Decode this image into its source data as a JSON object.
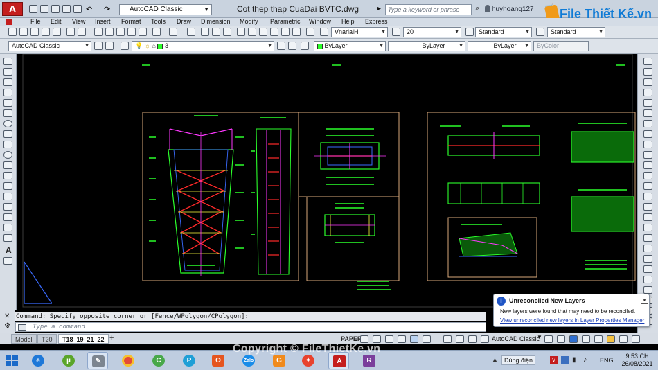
{
  "titlebar": {
    "app_logo": "A",
    "workspace": "AutoCAD Classic",
    "document_title": "Cot thep thap CuaDai BVTC.dwg",
    "search_placeholder": "Type a keyword or phrase",
    "user": "huyhoang127",
    "brand_text": "File Thiết Kế.vn"
  },
  "menu": {
    "items": [
      "File",
      "Edit",
      "View",
      "Insert",
      "Format",
      "Tools",
      "Draw",
      "Dimension",
      "Modify",
      "Parametric",
      "Window",
      "Help",
      "Express"
    ]
  },
  "toolbar_styles": {
    "text_style": "VnarialH",
    "text_height": "20",
    "dim_style": "Standard",
    "table_style": "Standard"
  },
  "toolbar_layers": {
    "workspace": "AutoCAD Classic",
    "current_layer": "3",
    "color": "ByLayer",
    "linetype": "ByLayer",
    "lineweight": "ByLayer",
    "plotstyle": "ByColor"
  },
  "command": {
    "history": "Command: Specify opposite corner or [Fence/WPolygon/CPolygon]:",
    "placeholder": "Type a command"
  },
  "layout_tabs": [
    "Model",
    "T20",
    "T18_19_21_22"
  ],
  "statusbar": {
    "space": "PAPER",
    "workspace": "AutoCAD Classic"
  },
  "balloon": {
    "title": "Unreconciled New Layers",
    "text": "New layers were found that may need to be reconciled.",
    "link": "View unreconciled new layers in Layer Properties Manager"
  },
  "taskbar": {
    "power_label": "Dùng điện",
    "lang": "ENG",
    "time": "9:53 CH",
    "date": "26/08/2021",
    "apps": [
      "start",
      "ie",
      "utorrent",
      "tool",
      "chrome",
      "cc",
      "paint",
      "office",
      "zalo",
      "foxit",
      "app",
      "autocad",
      "winrar"
    ]
  },
  "watermark": "Copyright © FileThietKe.vn",
  "colors": {
    "cad_green": "#2bff2b",
    "cad_magenta": "#ff38ff",
    "cad_red": "#ff2a2a",
    "cad_blue": "#3a6bff",
    "cad_yellow": "#ffff40",
    "frame": "#d9a87a"
  }
}
